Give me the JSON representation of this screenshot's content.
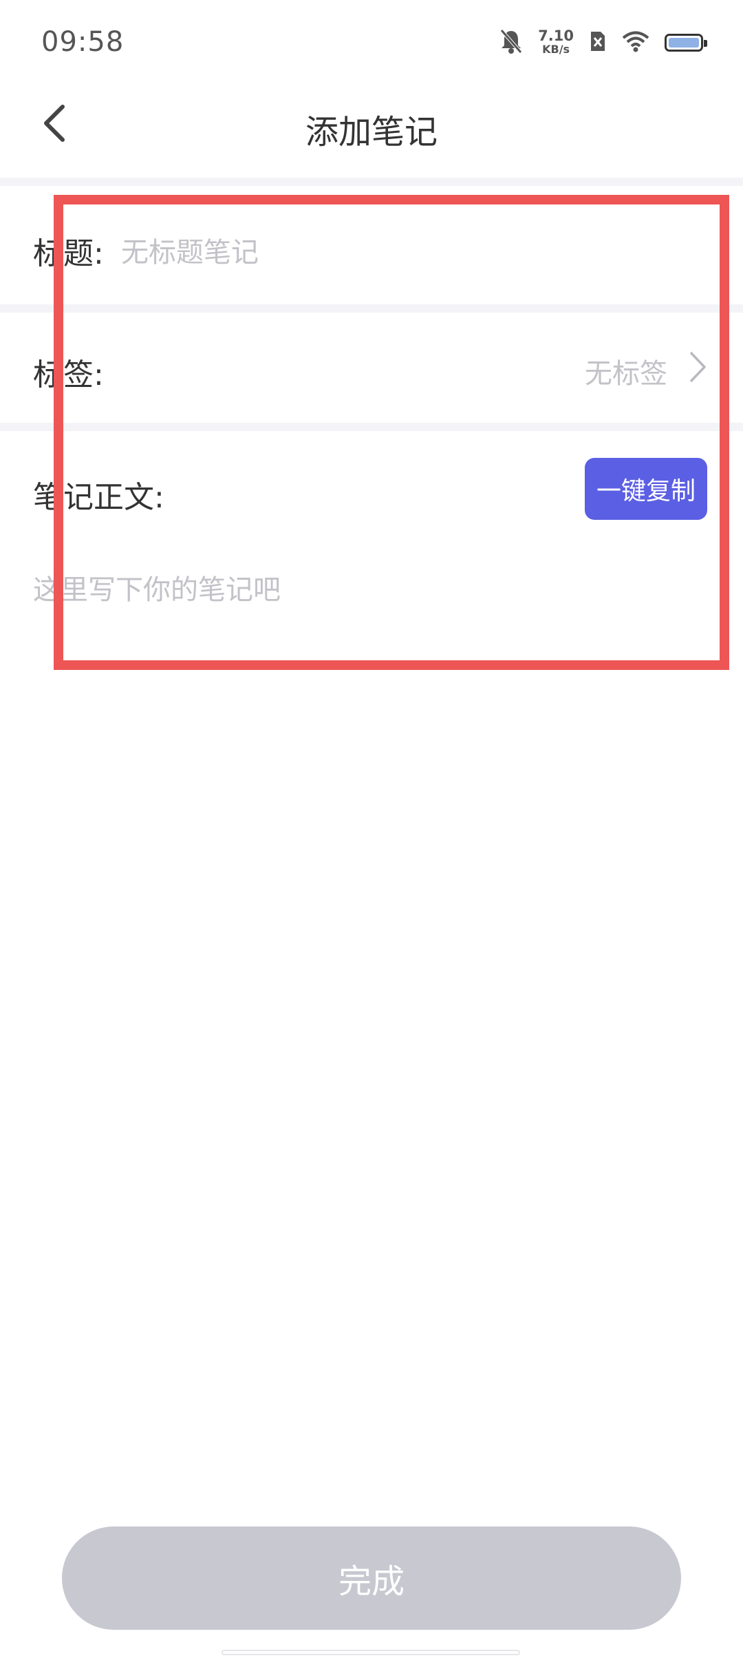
{
  "status_bar": {
    "time": "09:58",
    "net_speed_value": "7.10",
    "net_speed_unit": "KB/s",
    "icons": [
      "bell-muted-icon",
      "sim-x-icon",
      "wifi-icon",
      "battery-icon"
    ]
  },
  "header": {
    "title": "添加笔记",
    "back_icon": "chevron-left-icon"
  },
  "form": {
    "title_label": "标题:",
    "title_placeholder": "无标题笔记",
    "tag_label": "标签:",
    "tag_value": "无标签",
    "body_label": "笔记正文:",
    "copy_button": "一键复制",
    "body_placeholder": "这里写下你的笔记吧"
  },
  "footer": {
    "done_button": "完成"
  },
  "colors": {
    "accent": "#5b5fe3",
    "highlight": "#ee5555",
    "disabled_button": "#c7c8d0"
  }
}
